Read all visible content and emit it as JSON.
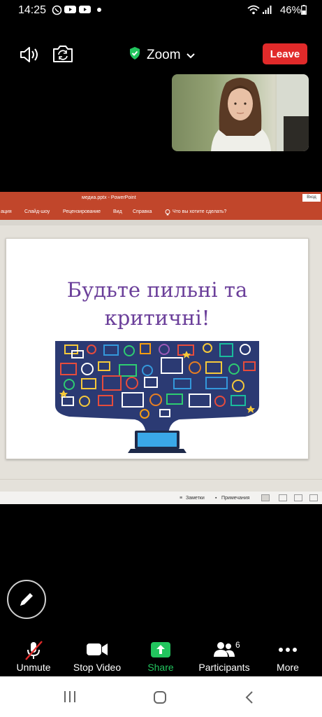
{
  "status_bar": {
    "time": "14:25",
    "battery": "46%"
  },
  "meeting": {
    "title": "Zoom",
    "leave_label": "Leave"
  },
  "ppt": {
    "window_title": "медиа.pptx - PowerPoint",
    "sign_in": "Вход",
    "ribbon_tabs": [
      "ация",
      "Слайд-шоу",
      "Рецензирование",
      "Вид",
      "Справка",
      "Что вы хотите сделать?"
    ],
    "status_bar": {
      "notes": "Заметки",
      "comments": "Примечания"
    }
  },
  "slide": {
    "line1": "Будьте пильні та",
    "line2": "критичні!"
  },
  "toolbar": {
    "unmute": "Unmute",
    "stop_video": "Stop Video",
    "share": "Share",
    "participants": "Participants",
    "participants_count": "6",
    "more": "More"
  },
  "colors": {
    "leave": "#e12a2a",
    "share": "#22c55e",
    "slide_title": "#6b3f9a",
    "ppt_ribbon": "#c1462b"
  }
}
